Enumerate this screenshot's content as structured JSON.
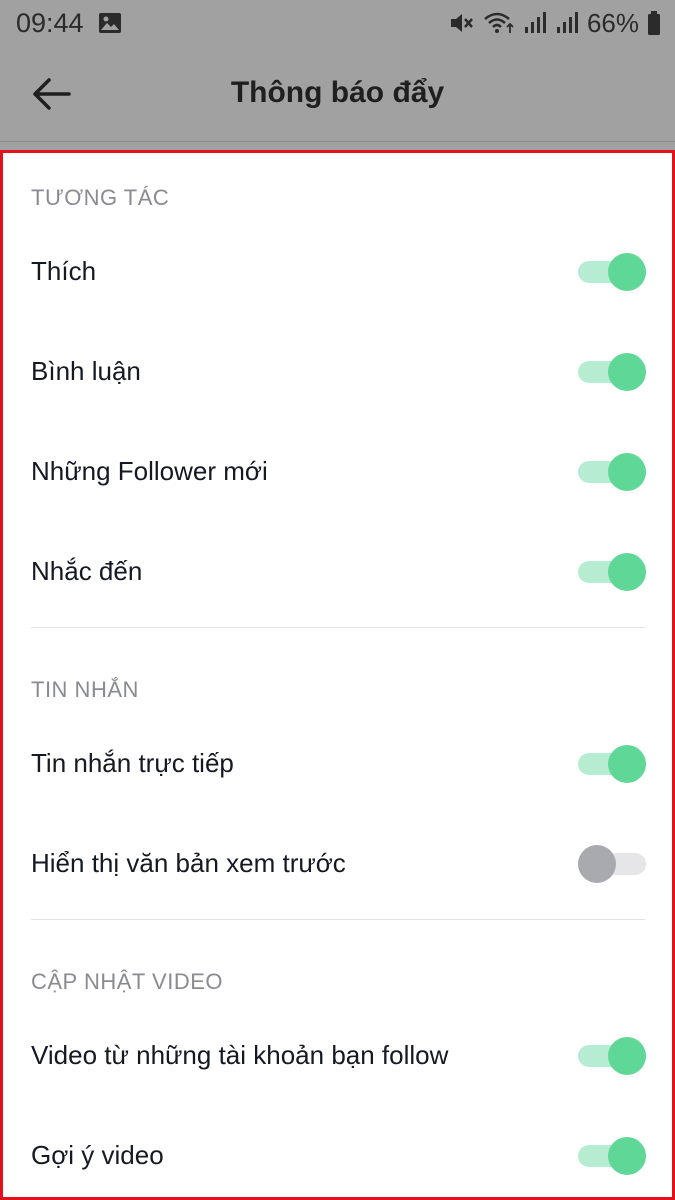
{
  "status_bar": {
    "time": "09:44",
    "battery": "66%",
    "icons": [
      "image-icon",
      "mute-icon",
      "wifi-icon",
      "signal-icon",
      "signal-icon",
      "battery-icon"
    ]
  },
  "header": {
    "title": "Thông báo đẩy",
    "back_icon": "arrow-left-icon"
  },
  "sections": [
    {
      "title": "TƯƠNG TÁC",
      "items": [
        {
          "label": "Thích",
          "enabled": true
        },
        {
          "label": "Bình luận",
          "enabled": true
        },
        {
          "label": "Những Follower mới",
          "enabled": true
        },
        {
          "label": "Nhắc đến",
          "enabled": true
        }
      ]
    },
    {
      "title": "TIN NHẮN",
      "items": [
        {
          "label": "Tin nhắn trực tiếp",
          "enabled": true
        },
        {
          "label": "Hiển thị văn bản xem trước",
          "enabled": false
        }
      ]
    },
    {
      "title": "CẬP NHẬT VIDEO",
      "items": [
        {
          "label": "Video từ những tài khoản bạn follow",
          "enabled": true
        },
        {
          "label": "Gợi ý video",
          "enabled": true
        }
      ]
    }
  ],
  "colors": {
    "toggle_on_knob": "#5fd897",
    "toggle_on_track": "#b5ecd2",
    "toggle_off_knob": "#a9aab0",
    "toggle_off_track": "#e6e6e8",
    "highlight_border": "#e3111a"
  }
}
